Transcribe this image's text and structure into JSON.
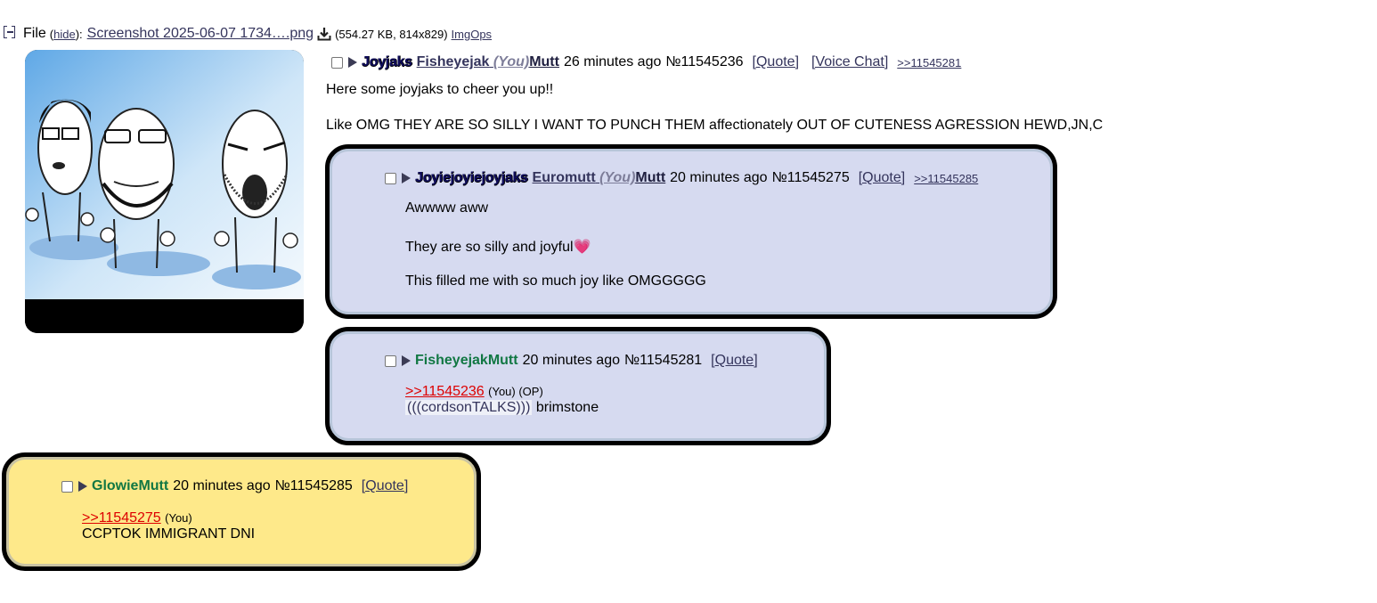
{
  "file": {
    "label": "File",
    "hide_label": "hide",
    "filename": "Screenshot 2025-06-07 1734….png",
    "meta": "(554.27 KB, 814x829)",
    "imgops_label": "ImgOps"
  },
  "op": {
    "subject": "Joyjaks",
    "name_part": "Fisheyejak",
    "you_tag": "(You)",
    "name_suffix": "Mutt",
    "time": "26 minutes ago",
    "number": "№11545236",
    "quote_label": "[Quote]",
    "voice_chat_label": "[Voice Chat]",
    "backlink": ">>11545281",
    "lines": [
      "Here some joyjaks to cheer you up!!",
      "Like OMG THEY ARE SO SILLY I WANT TO PUNCH THEM affectionately OUT OF CUTENESS AGRESSION HEWD,JN,C"
    ]
  },
  "reply1": {
    "subject": "Joyiejoyiejoyjaks",
    "name_part": "Euromutt",
    "you_tag": "(You)",
    "name_suffix": "Mutt",
    "time": "20 minutes ago",
    "number": "№11545275",
    "quote_label": "[Quote]",
    "backlink": ">>11545285",
    "line1": "Awwww aww",
    "line2": "They are so silly and joyful",
    "heart": "💗",
    "line3": "This filled me with so much joy like OMGGGGG"
  },
  "reply2": {
    "name": "FisheyejakMutt",
    "time": "20 minutes ago",
    "number": "№11545281",
    "quote_label": "[Quote]",
    "quotelink": ">>11545236",
    "quotelink_tags": "(You) (OP)",
    "cordson": "(((cordsonTALKS)))",
    "text": "brimstone"
  },
  "reply3": {
    "name": "GlowieMutt",
    "time": "20 minutes ago",
    "number": "№11545285",
    "quote_label": "[Quote]",
    "quotelink": ">>11545275",
    "quotelink_tags": "(You)",
    "text": "CCPTOK IMMIGRANT DNI"
  },
  "colors": {
    "reply_bg": "#d6daf0",
    "highlight_bg": "#fee98a",
    "name_green": "#117743",
    "link": "#34345c",
    "quotelink_red": "#dd0000"
  }
}
